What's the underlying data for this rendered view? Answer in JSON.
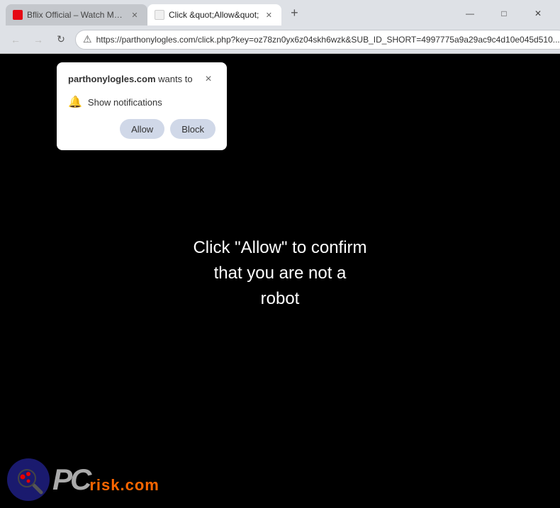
{
  "browser": {
    "tabs": [
      {
        "id": "tab-bflix",
        "title": "Bflix Official – Watch Movies a...",
        "active": false,
        "favicon": "bflix"
      },
      {
        "id": "tab-allow",
        "title": "Click &quot;Allow&quot;",
        "active": true,
        "favicon": "alert"
      }
    ],
    "add_tab_label": "+",
    "window_controls": {
      "minimize": "—",
      "maximize": "□",
      "close": "✕"
    },
    "address_bar": {
      "url": "https://parthonylogles.com/click.php?key=oz78zn0yx6z04skh6wzk&SUB_ID_SHORT=4997775a9a29ac9c4d10e045d510...",
      "lock_icon": "⚠"
    },
    "nav": {
      "back": "←",
      "forward": "→",
      "reload": "↻",
      "home": "⌂"
    }
  },
  "popup": {
    "domain": "parthonylogles.com",
    "wants_to": " wants to",
    "notification_label": "Show notifications",
    "allow_label": "Allow",
    "block_label": "Block",
    "close_label": "×"
  },
  "page": {
    "background_color": "#000000",
    "message_line1": "Click \"Allow\" to confirm",
    "message_line2": "that you are not a",
    "message_line3": "robot"
  },
  "logo": {
    "pc_text": "PC",
    "risk_text": "risk.com"
  }
}
